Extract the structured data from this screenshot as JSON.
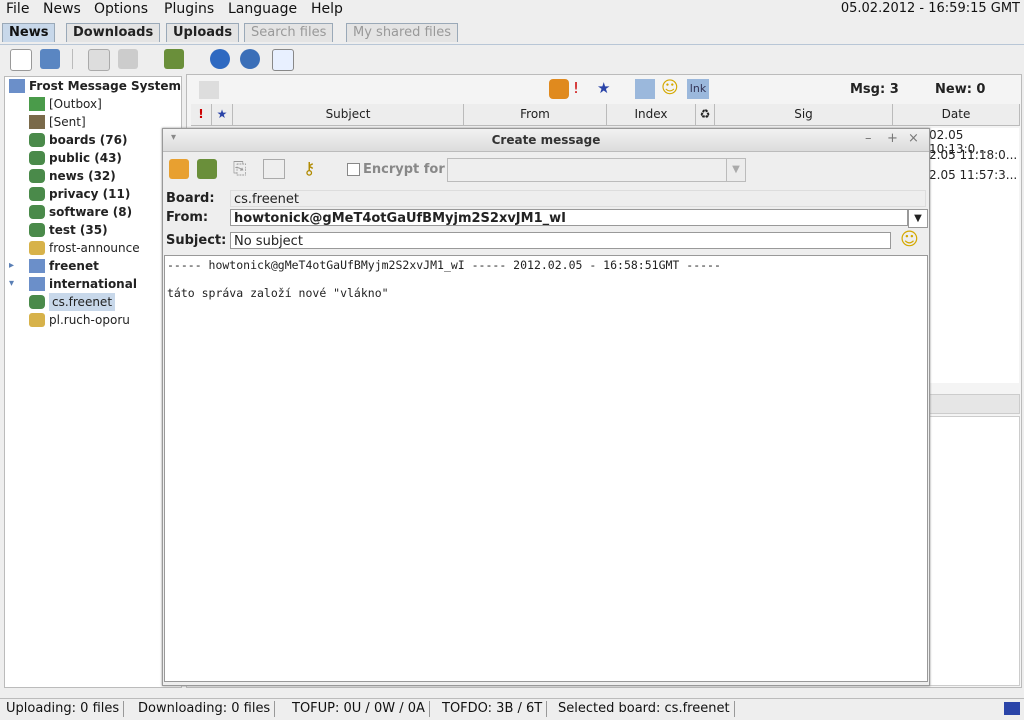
{
  "menu": {
    "items": [
      "File",
      "News",
      "Options",
      "Plugins",
      "Language",
      "Help"
    ],
    "clock": "05.02.2012 - 16:59:15 GMT"
  },
  "tabs": [
    {
      "label": "News",
      "state": "active"
    },
    {
      "label": "Downloads",
      "state": "normal"
    },
    {
      "label": "Uploads",
      "state": "normal"
    },
    {
      "label": "Search files",
      "state": "disabled"
    },
    {
      "label": "My shared files",
      "state": "disabled"
    }
  ],
  "tree": {
    "root": "Frost Message System",
    "items": [
      {
        "label": "[Outbox]",
        "bold": false,
        "icon": "outbox-icon"
      },
      {
        "label": "[Sent]",
        "bold": false,
        "icon": "sent-book-icon"
      },
      {
        "label": "boards (76)",
        "bold": true,
        "icon": "board-icon"
      },
      {
        "label": "public (43)",
        "bold": true,
        "icon": "board-icon"
      },
      {
        "label": "news (32)",
        "bold": true,
        "icon": "board-icon"
      },
      {
        "label": "privacy (11)",
        "bold": true,
        "icon": "board-icon"
      },
      {
        "label": "software (8)",
        "bold": true,
        "icon": "board-icon"
      },
      {
        "label": "test (35)",
        "bold": true,
        "icon": "board-icon"
      },
      {
        "label": "frost-announce",
        "bold": false,
        "icon": "lock-icon"
      },
      {
        "label": "freenet",
        "bold": true,
        "icon": "folder-icon"
      },
      {
        "label": "international",
        "bold": true,
        "icon": "folder-icon"
      },
      {
        "label": "cs.freenet",
        "bold": false,
        "icon": "board-icon"
      },
      {
        "label": "pl.ruch-oporu",
        "bold": false,
        "icon": "lock-icon"
      }
    ]
  },
  "messages": {
    "msg_label": "Msg: 3",
    "new_label": "New: 0",
    "columns": [
      "!",
      "★",
      "Subject",
      "From",
      "Index",
      "♻",
      "Sig",
      "Date"
    ],
    "dates": [
      "02.05 10:13:0...",
      "2.05 11:18:0...",
      "2.05 11:57:3..."
    ]
  },
  "dialog": {
    "title": "Create message",
    "encrypt_label": "Encrypt for",
    "board_label": "Board:",
    "board_value": "cs.freenet",
    "from_label": "From:",
    "from_value": "howtonick@gMeT4otGaUfBMyjm2S2xvJM1_wI",
    "subject_label": "Subject:",
    "subject_value": "No subject",
    "body_line1": "----- howtonick@gMeT4otGaUfBMyjm2S2xvJM1_wI ----- 2012.02.05 - 16:58:51GMT -----",
    "body_line2": "táto správa založí nové \"vlákno\""
  },
  "status": {
    "uploading": "Uploading: 0 files",
    "downloading": "Downloading: 0 files",
    "tofup": "TOFUP: 0U / 0W / 0A",
    "tofdo": "TOFDO: 3B / 6T",
    "selected": "Selected board: cs.freenet"
  }
}
